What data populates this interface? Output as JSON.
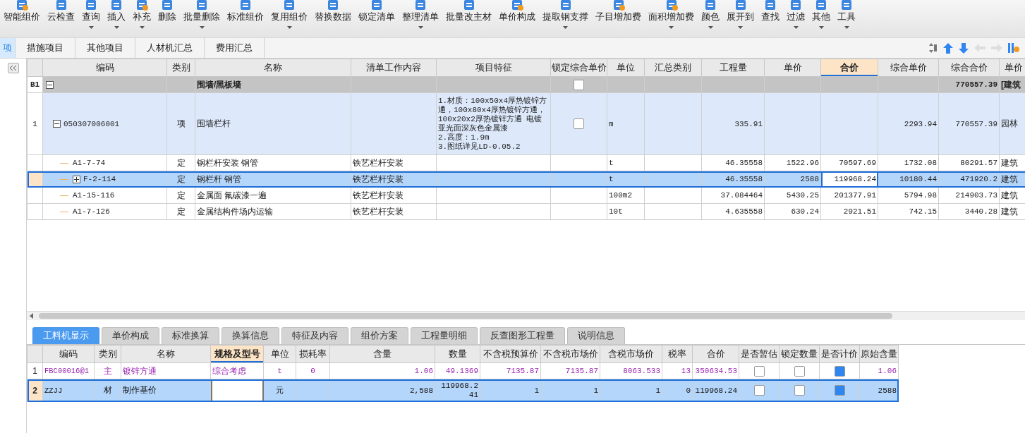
{
  "toolbar": [
    {
      "label": "智能组价",
      "dropdown": false
    },
    {
      "label": "云检查",
      "dropdown": false
    },
    {
      "label": "查询",
      "dropdown": true
    },
    {
      "label": "插入",
      "dropdown": true
    },
    {
      "label": "补充",
      "dropdown": true
    },
    {
      "label": "删除",
      "dropdown": false
    },
    {
      "label": "批量删除",
      "dropdown": true
    },
    {
      "label": "标准组价",
      "dropdown": false
    },
    {
      "label": "复用组价",
      "dropdown": true
    },
    {
      "label": "替换数据",
      "dropdown": false
    },
    {
      "label": "锁定清单",
      "dropdown": false
    },
    {
      "label": "整理清单",
      "dropdown": true
    },
    {
      "label": "批量改主材",
      "dropdown": false
    },
    {
      "label": "单价构成",
      "dropdown": false
    },
    {
      "label": "提取钢支撑",
      "dropdown": true
    },
    {
      "label": "子目增加费",
      "dropdown": false
    },
    {
      "label": "面积增加费",
      "dropdown": true
    },
    {
      "label": "颜色",
      "dropdown": true
    },
    {
      "label": "展开到",
      "dropdown": true
    },
    {
      "label": "查找",
      "dropdown": false
    },
    {
      "label": "过滤",
      "dropdown": true
    },
    {
      "label": "其他",
      "dropdown": true
    },
    {
      "label": "工具",
      "dropdown": true
    }
  ],
  "tabs": [
    {
      "label": "项",
      "selected": true
    },
    {
      "label": "措施项目",
      "selected": false
    },
    {
      "label": "其他项目",
      "selected": false
    },
    {
      "label": "人材机汇总",
      "selected": false
    },
    {
      "label": "费用汇总",
      "selected": false
    }
  ],
  "table": {
    "columns": [
      {
        "label": "编码",
        "selected": false
      },
      {
        "label": "类别",
        "selected": false
      },
      {
        "label": "名称",
        "selected": false
      },
      {
        "label": "清单工作内容",
        "selected": false
      },
      {
        "label": "项目特征",
        "selected": false
      },
      {
        "label": "锁定综合单价",
        "selected": false
      },
      {
        "label": "单位",
        "selected": false
      },
      {
        "label": "汇总类别",
        "selected": false
      },
      {
        "label": "工程量",
        "selected": false
      },
      {
        "label": "单价",
        "selected": false
      },
      {
        "label": "合价",
        "selected": true
      },
      {
        "label": "综合单价",
        "selected": false
      },
      {
        "label": "综合合价",
        "selected": false
      },
      {
        "label": "单价",
        "selected": false
      }
    ],
    "rows": [
      {
        "kind": "group",
        "num": "B1",
        "expanded": true,
        "selected": false,
        "name": "围墙/黑板墙",
        "locked": false,
        "comp_total": "770557.39",
        "col14": "[建筑",
        "children": [
          {
            "kind": "item",
            "num": "1",
            "expanded": true,
            "selected": false,
            "code": "050307006001",
            "type": "项",
            "name": "围墙栏杆",
            "feature": "1.材质：100x50x4厚热镀锌方通，100x80x4厚热镀锌方通，100x20x2厚热镀锌方通 电镀亚光面深灰色金属漆\n2.高度：1.9m\n3.图纸详见LD-0.05.2",
            "locked": false,
            "unit": "m",
            "qty": "335.91",
            "comp_price": "2293.94",
            "comp_total": "770557.39",
            "col14": "园林",
            "children": [
              {
                "kind": "quota",
                "selected": false,
                "code": "A1-7-74",
                "type": "定",
                "name": "钢栏杆安装 钢管",
                "content": "铁艺栏杆安装",
                "unit": "t",
                "qty": "46.35558",
                "price": "1522.96",
                "total": "70597.69",
                "comp_price": "1732.08",
                "comp_total": "80291.57",
                "col14": "建筑"
              },
              {
                "kind": "quota",
                "expanded": false,
                "selected": true,
                "code": "F-2-114",
                "type": "定",
                "name": "钢栏杆 钢管",
                "content": "铁艺栏杆安装",
                "unit": "t",
                "qty": "46.35558",
                "price": "2588",
                "total": "119968.24",
                "comp_price": "10180.44",
                "comp_total": "471920.2",
                "col14": "建筑"
              },
              {
                "kind": "quota",
                "selected": false,
                "code": "A1-15-116",
                "type": "定",
                "name": "金属面 氟碳漆一遍",
                "content": "铁艺栏杆安装",
                "unit": "100m2",
                "qty": "37.084464",
                "price": "5430.25",
                "total": "201377.91",
                "comp_price": "5794.98",
                "comp_total": "214903.73",
                "col14": "建筑"
              },
              {
                "kind": "quota",
                "selected": false,
                "code": "A1-7-126",
                "type": "定",
                "name": "金属结构件场内运输",
                "content": "铁艺栏杆安装",
                "unit": "10t",
                "qty": "4.635558",
                "price": "630.24",
                "total": "2921.51",
                "comp_price": "742.15",
                "comp_total": "3440.28",
                "col14": "建筑"
              }
            ]
          }
        ]
      }
    ]
  },
  "detail_tabs": [
    {
      "label": "工料机显示",
      "selected": true
    },
    {
      "label": "单价构成",
      "selected": false
    },
    {
      "label": "标准换算",
      "selected": false
    },
    {
      "label": "换算信息",
      "selected": false
    },
    {
      "label": "特征及内容",
      "selected": false
    },
    {
      "label": "组价方案",
      "selected": false
    },
    {
      "label": "工程量明细",
      "selected": false
    },
    {
      "label": "反查图形工程量",
      "selected": false
    },
    {
      "label": "说明信息",
      "selected": false
    }
  ],
  "detail_table": {
    "columns": [
      {
        "label": "编码",
        "selected": false
      },
      {
        "label": "类别",
        "selected": false
      },
      {
        "label": "名称",
        "selected": false
      },
      {
        "label": "规格及型号",
        "selected": true
      },
      {
        "label": "单位",
        "selected": false
      },
      {
        "label": "损耗率",
        "selected": false
      },
      {
        "label": "含量",
        "selected": false
      },
      {
        "label": "数量",
        "selected": false
      },
      {
        "label": "不含税预算价",
        "selected": false
      },
      {
        "label": "不含税市场价",
        "selected": false
      },
      {
        "label": "含税市场价",
        "selected": false
      },
      {
        "label": "税率",
        "selected": false
      },
      {
        "label": "合价",
        "selected": false
      },
      {
        "label": "是否暂估",
        "selected": false
      },
      {
        "label": "锁定数量",
        "selected": false
      },
      {
        "label": "是否计价",
        "selected": false
      },
      {
        "label": "原始含量",
        "selected": false
      }
    ],
    "rows": [
      {
        "num": "1",
        "kind": "main",
        "selected": false,
        "code": "FBC00016@1",
        "type": "主",
        "name": "镀锌方通",
        "spec": "综合考虑",
        "unit": "t",
        "loss": "0",
        "content": "1.06",
        "qty": "49.1369",
        "budget": "7135.87",
        "market": "7135.87",
        "market_tax": "8063.533",
        "tax": "13",
        "total": "350634.53",
        "provisional": false,
        "lock_qty": false,
        "priced": true,
        "orig": "1.06"
      },
      {
        "num": "2",
        "kind": "normal",
        "selected": true,
        "code": "ZZJJ",
        "type": "材",
        "name": "制作基价",
        "unit": "元",
        "content": "2,588",
        "qty": "119968.241",
        "budget": "1",
        "market": "1",
        "market_tax": "1",
        "tax": "0",
        "total": "119968.24",
        "provisional": false,
        "lock_qty": false,
        "priced": true,
        "orig": "2588"
      }
    ]
  }
}
